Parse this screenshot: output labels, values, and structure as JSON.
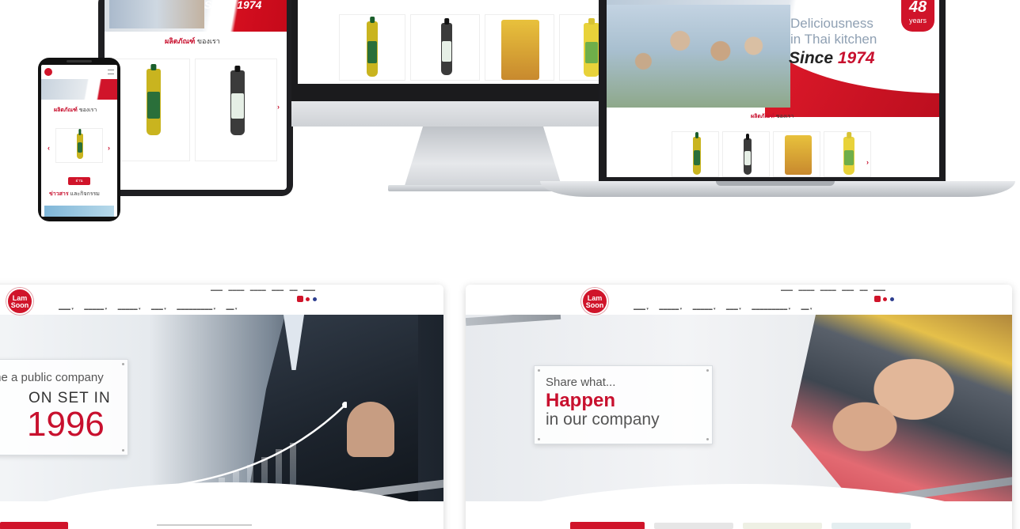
{
  "tablet": {
    "since_prefix": "Since",
    "since_year": "1974",
    "section_title_red": "ผลิตภัณฑ์",
    "section_title_dark": "ของเรา"
  },
  "phone": {
    "section_title_red": "ผลิตภัณฑ์",
    "section_title_dark": "ของเรา",
    "button_label": "อ่าน",
    "news_title_red": "ข่าวสาร",
    "news_title_dark": "และกิจกรรม"
  },
  "laptop": {
    "years_number": "48",
    "years_label": "years",
    "tagline_line1": "Deliciousness",
    "tagline_line2": "in Thai kitchen",
    "since_prefix": "Since",
    "since_year": "1974",
    "section_title_red": "ผลิตภัณฑ์",
    "section_title_dark": "ของเรา"
  },
  "site_left": {
    "logo_text": "Lam Soon",
    "hero_line1": "me a public company",
    "hero_line2": "ON SET IN",
    "hero_line3": "1996"
  },
  "site_right": {
    "logo_text": "Lam Soon",
    "hero_line1": "Share what...",
    "hero_line2": "Happen",
    "hero_line3": "in our company"
  },
  "colors": {
    "brand_red": "#c8102e",
    "dark": "#1c1c1f"
  }
}
